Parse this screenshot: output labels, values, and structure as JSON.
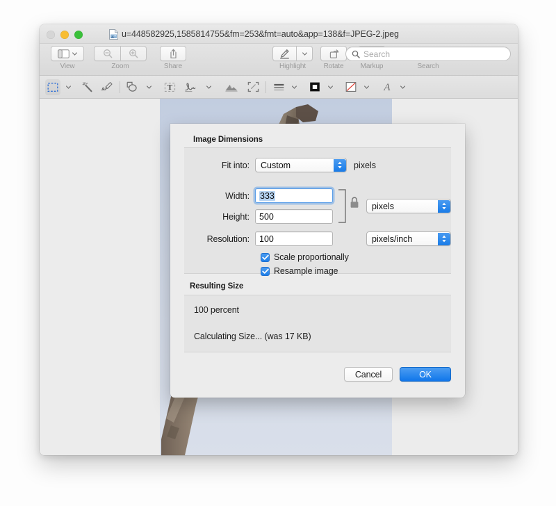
{
  "window": {
    "title": "u=448582925,1585814755&fm=253&fmt=auto&app=138&f=JPEG-2.jpeg",
    "doc_icon": "jpeg-document-icon",
    "traffic_lights": [
      {
        "name": "close-button",
        "color": "#d6d6d6",
        "state": "disabled"
      },
      {
        "name": "minimize-button",
        "color": "#f8bd33",
        "state": "enabled"
      },
      {
        "name": "maximize-button",
        "color": "#3ac03a",
        "state": "enabled"
      }
    ]
  },
  "toolbar": {
    "groups": [
      {
        "label": "View",
        "icon": "sidebar-icon",
        "has_chevron": true,
        "enabled": true
      },
      {
        "label": "Zoom",
        "icons": [
          "zoom-out-icon",
          "zoom-in-icon"
        ],
        "enabled": false
      },
      {
        "label": "Share",
        "icon": "share-icon",
        "enabled": true
      },
      {
        "label": "Highlight",
        "icon": "highlighter-pen-icon",
        "has_chevron": true,
        "enabled": true
      },
      {
        "label": "Rotate",
        "icon": "rotate-left-icon",
        "enabled": true
      },
      {
        "label": "Markup",
        "icon": "markup-pen-circle-icon",
        "enabled": true,
        "active": true
      }
    ],
    "search": {
      "label": "Search",
      "placeholder": "Search",
      "icon": "search-icon",
      "value": ""
    }
  },
  "markup_bar": {
    "tools": [
      {
        "name": "rectangular-selection-icon",
        "chevron": true,
        "selected": true
      },
      {
        "name": "instant-alpha-magic-wand-icon",
        "chevron": false,
        "selected": false
      },
      {
        "name": "sketch-pen-icon",
        "chevron": false,
        "selected": false
      },
      {
        "name": "shapes-icon",
        "chevron": true,
        "selected": false
      },
      {
        "name": "text-box-icon",
        "chevron": false,
        "selected": false
      },
      {
        "name": "signature-icon",
        "chevron": true,
        "selected": false
      },
      {
        "name": "adjust-color-icon",
        "chevron": false,
        "selected": false
      },
      {
        "name": "crop-icon",
        "chevron": false,
        "selected": false
      },
      {
        "name": "shape-style-icon",
        "chevron": true,
        "selected": false
      },
      {
        "name": "border-color-icon",
        "chevron": true,
        "selected": false
      },
      {
        "name": "fill-color-icon",
        "chevron": true,
        "selected": false
      },
      {
        "name": "text-style-icon",
        "chevron": true,
        "selected": false
      }
    ]
  },
  "dialog": {
    "image_dimensions": {
      "section_title": "Image Dimensions",
      "fit_into": {
        "label": "Fit into:",
        "value": "Custom",
        "suffix": "pixels",
        "options": [
          "Custom"
        ]
      },
      "width": {
        "label": "Width:",
        "value": "333",
        "selected": true,
        "focused": true
      },
      "height": {
        "label": "Height:",
        "value": "500"
      },
      "dimension_unit": {
        "value": "pixels",
        "options": [
          "pixels"
        ]
      },
      "resolution": {
        "label": "Resolution:",
        "value": "100"
      },
      "resolution_unit": {
        "value": "pixels/inch",
        "options": [
          "pixels/inch"
        ]
      },
      "link_icon": "locked-padlock-icon",
      "checkboxes": [
        {
          "label": "Scale proportionally",
          "checked": true
        },
        {
          "label": "Resample image",
          "checked": true
        }
      ]
    },
    "resulting_size": {
      "section_title": "Resulting Size",
      "percent_line": "100 percent",
      "size_line": "Calculating Size... (was 17 KB)"
    },
    "buttons": {
      "cancel": "Cancel",
      "ok": "OK"
    }
  },
  "colors": {
    "accent": "#1076ea",
    "window_chrome": "#ececec",
    "group_box": "#e4e4e4",
    "sky": "#ccd5e4",
    "branch": "#8a7a68"
  }
}
